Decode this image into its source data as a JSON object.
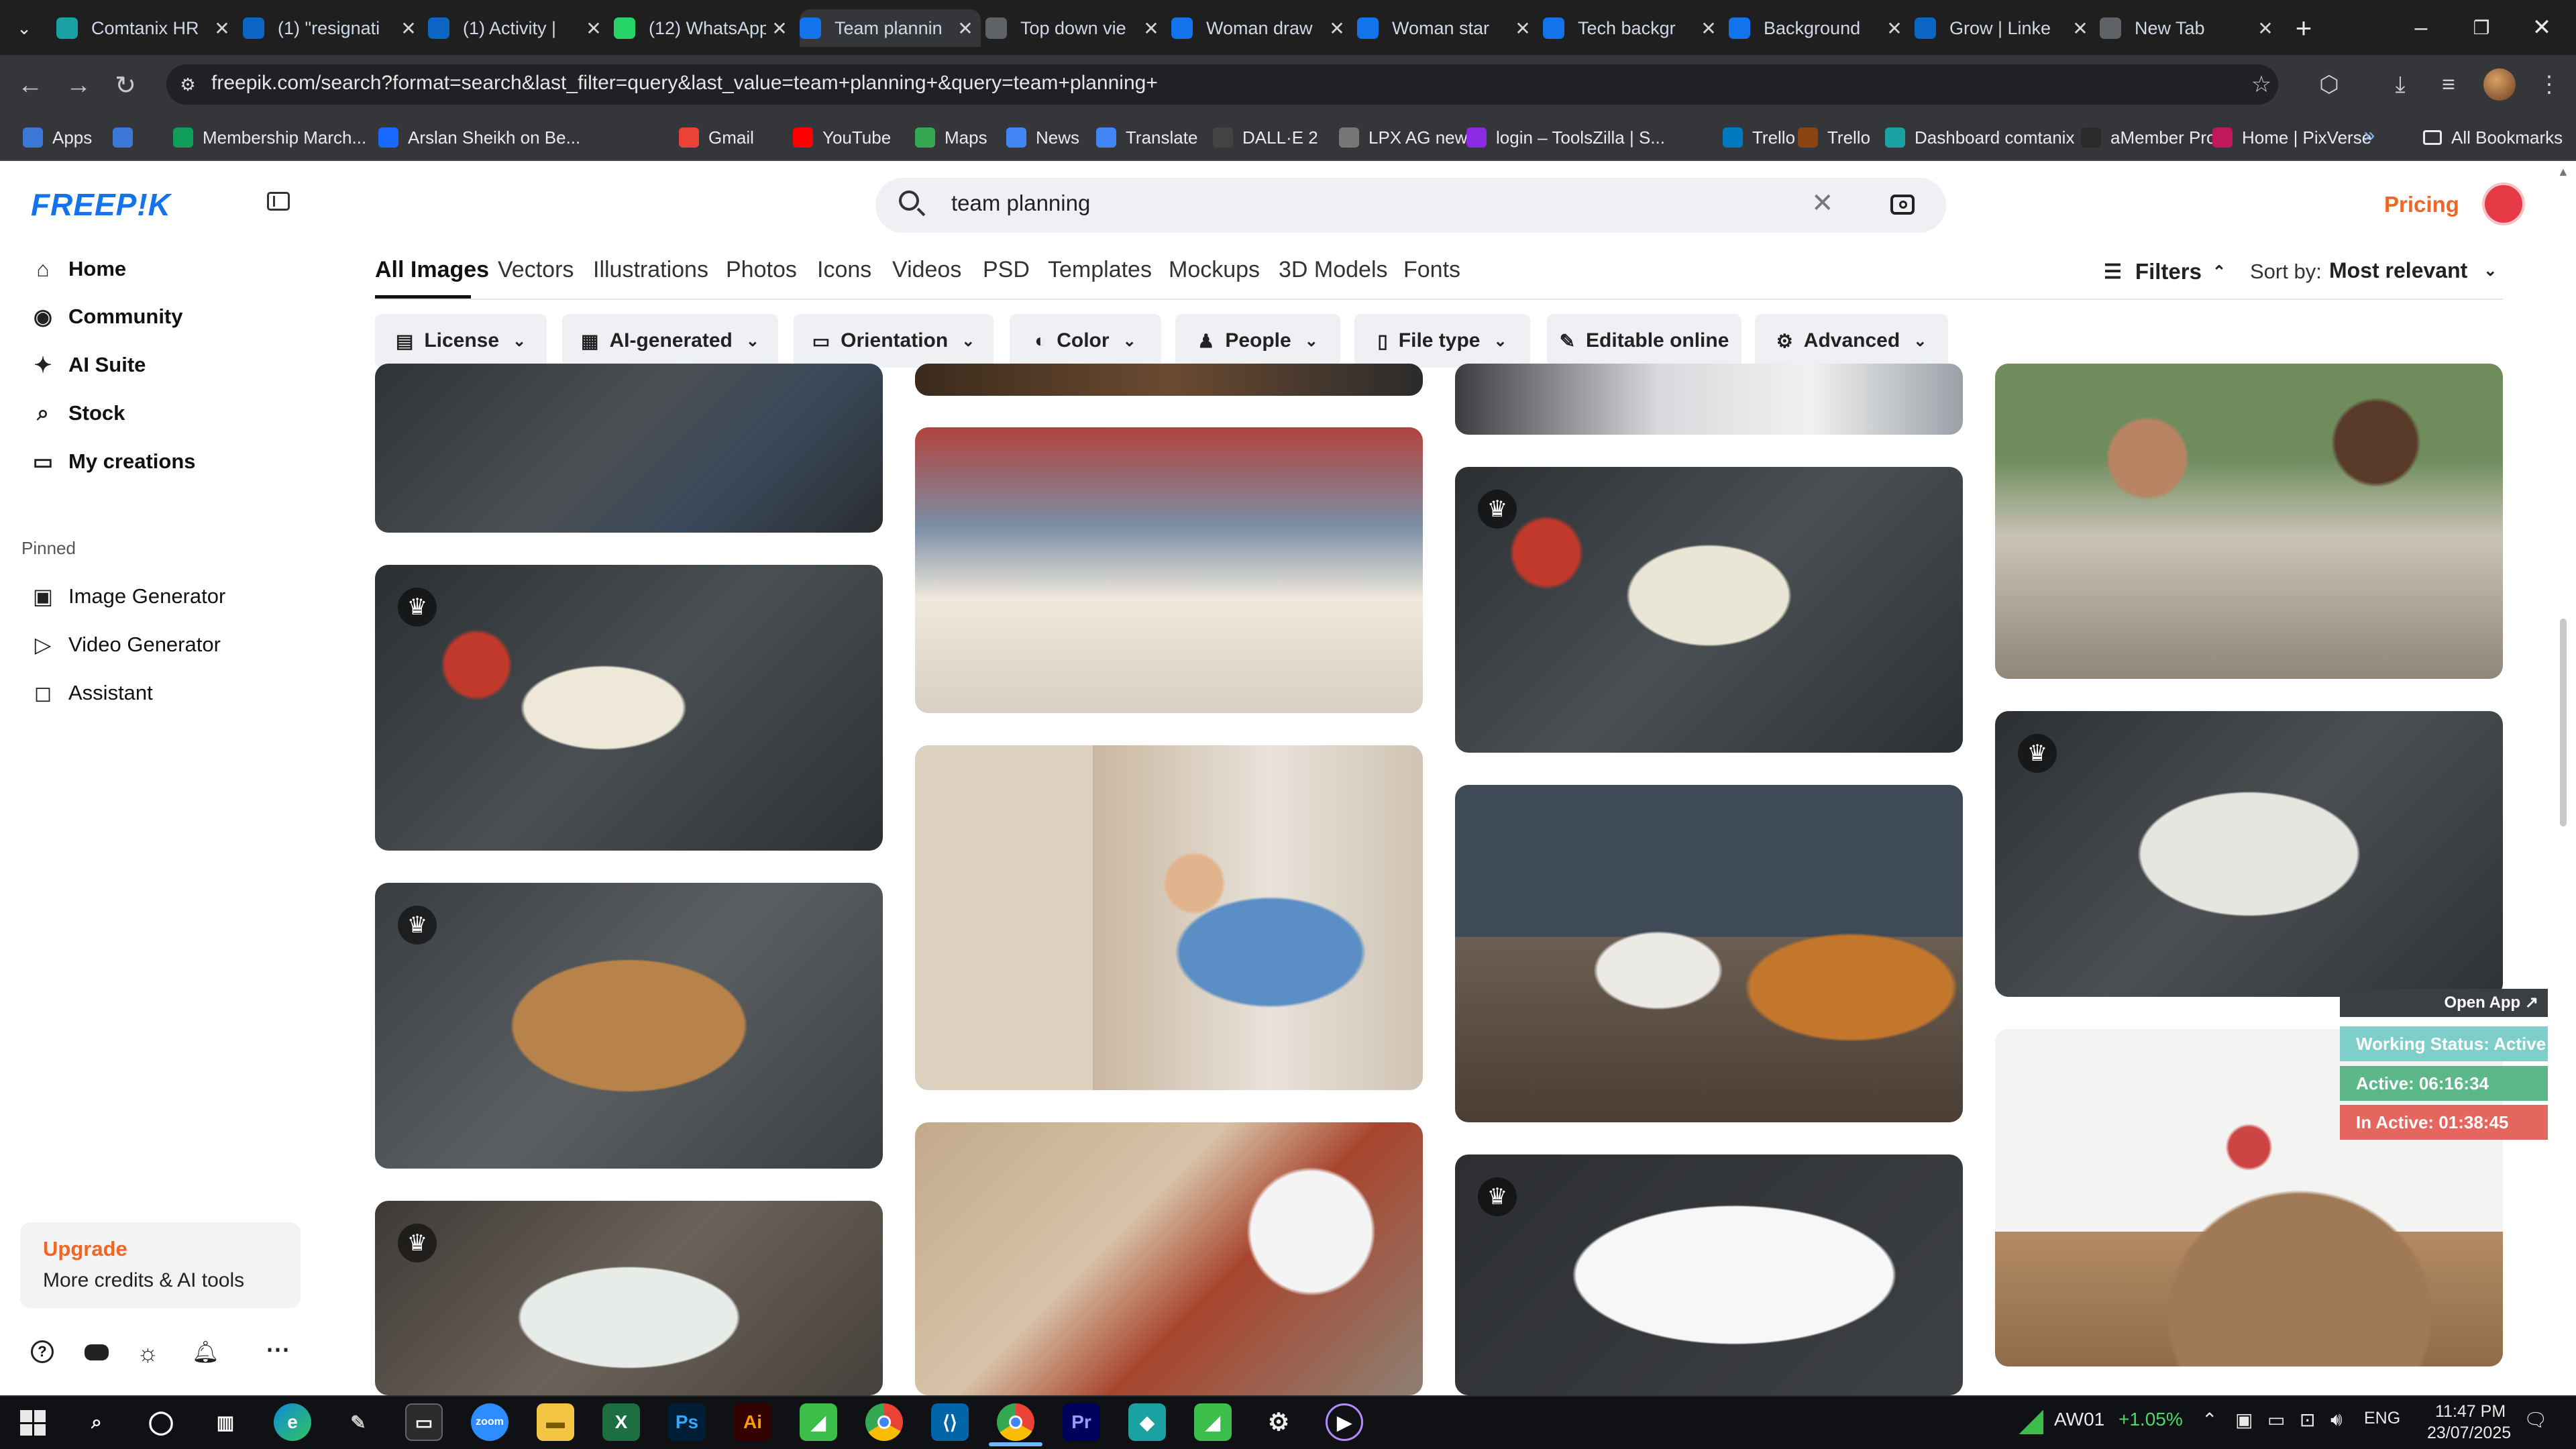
{
  "browser": {
    "tabs": [
      {
        "title": "Comtanix HR",
        "icon": "comtanix-icon",
        "color": "#1aa1a1"
      },
      {
        "title": "(1) \"resignati",
        "icon": "linkedin-icon",
        "color": "#0a66c2"
      },
      {
        "title": "(1) Activity | ",
        "icon": "linkedin-icon",
        "color": "#0a66c2"
      },
      {
        "title": "(12) WhatsApp",
        "icon": "whatsapp-icon",
        "color": "#25d366"
      },
      {
        "title": "Team plannin",
        "icon": "freepik-icon",
        "color": "#1273eb"
      },
      {
        "title": "Top down vie",
        "icon": "globe-icon",
        "color": "#5f6368"
      },
      {
        "title": "Woman draw",
        "icon": "freepik-icon",
        "color": "#1273eb"
      },
      {
        "title": "Woman star",
        "icon": "freepik-icon",
        "color": "#1273eb"
      },
      {
        "title": "Tech backgr",
        "icon": "freepik-icon",
        "color": "#1273eb"
      },
      {
        "title": "Background",
        "icon": "freepik-icon",
        "color": "#1273eb"
      },
      {
        "title": "Grow | Linke",
        "icon": "linkedin-icon",
        "color": "#0a66c2"
      },
      {
        "title": "New Tab",
        "icon": "globe-icon",
        "color": "#5f6368"
      }
    ],
    "new_tab": "+",
    "url": "freepik.com/search?format=search&last_filter=query&last_value=team+planning+&query=team+planning+",
    "bookmarks": [
      {
        "label": "Apps",
        "icon": "apps-grid-icon",
        "color": "#3c78d8"
      },
      {
        "label": "",
        "icon": "tab-grid-icon",
        "color": "#3c78d8"
      },
      {
        "label": "Membership March...",
        "icon": "bookmark-icon",
        "color": "#0f9d58"
      },
      {
        "label": "Arslan Sheikh on Be...",
        "icon": "behance-icon",
        "color": "#1769ff"
      },
      {
        "label": "Gmail",
        "icon": "gmail-icon",
        "color": "#ea4335"
      },
      {
        "label": "YouTube",
        "icon": "youtube-icon",
        "color": "#ff0000"
      },
      {
        "label": "Maps",
        "icon": "maps-icon",
        "color": "#34a853"
      },
      {
        "label": "News",
        "icon": "news-icon",
        "color": "#4285f4"
      },
      {
        "label": "Translate",
        "icon": "translate-icon",
        "color": "#4285f4"
      },
      {
        "label": "DALL·E 2",
        "icon": "openai-icon",
        "color": "#444444"
      },
      {
        "label": "LPX AG new",
        "icon": "doc-icon",
        "color": "#777777"
      },
      {
        "label": "login – ToolsZilla | S...",
        "icon": "toolszilla-icon",
        "color": "#8a2be2"
      },
      {
        "label": "Trello",
        "icon": "trello-icon",
        "color": "#0079bf"
      },
      {
        "label": "Trello",
        "icon": "trello-icon",
        "color": "#8b4513"
      },
      {
        "label": "Dashboard comtanix",
        "icon": "comtanix-icon",
        "color": "#1aa1a1"
      },
      {
        "label": "aMember Pro",
        "icon": "amember-icon",
        "color": "#2b2b2b"
      },
      {
        "label": "Home | PixVerse",
        "icon": "pixverse-icon",
        "color": "#c2185b"
      }
    ],
    "all_bookmarks": "All Bookmarks"
  },
  "site": {
    "logo": "FREEP!K",
    "brand_color": "#1273eb",
    "accent_color": "#f26522",
    "nav": [
      {
        "label": "Home",
        "icon": "home-icon"
      },
      {
        "label": "Community",
        "icon": "community-icon"
      },
      {
        "label": "AI Suite",
        "icon": "ai-sparkle-icon"
      },
      {
        "label": "Stock",
        "icon": "search-icon"
      },
      {
        "label": "My creations",
        "icon": "folder-icon"
      }
    ],
    "pinned_heading": "Pinned",
    "pinned": [
      {
        "label": "Image Generator",
        "icon": "image-icon"
      },
      {
        "label": "Video Generator",
        "icon": "video-icon"
      },
      {
        "label": "Assistant",
        "icon": "chat-icon"
      }
    ],
    "upgrade": {
      "title": "Upgrade",
      "subtitle": "More credits & AI tools"
    },
    "search_value": "team planning",
    "pricing": "Pricing",
    "tabs": [
      "All Images",
      "Vectors",
      "Illustrations",
      "Photos",
      "Icons",
      "Videos",
      "PSD",
      "Templates",
      "Mockups",
      "3D Models",
      "Fonts"
    ],
    "active_tab": "All Images",
    "filters_label": "Filters",
    "sort_label": "Sort by:",
    "sort_value": "Most relevant",
    "chips": [
      {
        "label": "License",
        "icon": "license-icon"
      },
      {
        "label": "AI-generated",
        "icon": "ai-generated-icon"
      },
      {
        "label": "Orientation",
        "icon": "orientation-icon"
      },
      {
        "label": "Color",
        "icon": "color-icon"
      },
      {
        "label": "People",
        "icon": "people-icon"
      },
      {
        "label": "File type",
        "icon": "file-icon"
      },
      {
        "label": "Editable online",
        "icon": "edit-icon"
      },
      {
        "label": "Advanced",
        "icon": "gear-icon"
      }
    ]
  },
  "tracker": {
    "open_app": "Open App ↗",
    "status": "Working Status: Active",
    "active": "Active: 06:16:34",
    "inactive": "In Active: 01:38:45"
  },
  "taskbar": {
    "ticker": "AW01",
    "change": "+1.05%",
    "lang": "ENG",
    "time": "11:47 PM",
    "date": "23/07/2025"
  }
}
